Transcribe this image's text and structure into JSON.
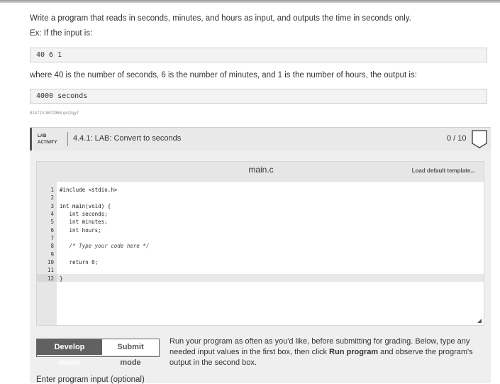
{
  "prompt": {
    "line1": "Write a program that reads in seconds, minutes, and hours as input, and outputs the time in seconds only.",
    "line2": "Ex: If the input is:",
    "example_input": "40 6 1",
    "line3": "where 40 is the number of seconds, 6 is the number of minutes, and 1 is the number of hours, the output is:",
    "example_output": "4000 seconds",
    "id": "814710.3672968.qx3zqy7"
  },
  "lab": {
    "tag_line1": "LAB",
    "tag_line2": "ACTIVITY",
    "title": "4.4.1: LAB: Convert to seconds",
    "score": "0 / 10"
  },
  "editor": {
    "file_name": "main.c",
    "load_template": "Load default template...",
    "line_numbers": [
      "1",
      "2",
      "3",
      "4",
      "5",
      "6",
      "7",
      "8",
      "9",
      "10",
      "11",
      "12"
    ],
    "lines": [
      "#include <stdio.h>",
      "",
      "int main(void) {",
      "   int seconds;",
      "   int minutes;",
      "   int hours;",
      "",
      "   /* Type your code here */",
      "",
      "   return 0;",
      "",
      "}"
    ]
  },
  "modes": {
    "develop": "Develop mode",
    "submit": "Submit mode",
    "desc_part1": "Run your program as often as you'd like, before submitting for grading. Below, type any needed input values in the first box, then click ",
    "desc_bold": "Run program",
    "desc_part2": " and observe the program's output in the second box."
  },
  "input_label": "Enter program input (optional)",
  "colors": {
    "active_mode": "#616161",
    "editor_bg": "#e6e6e6"
  }
}
